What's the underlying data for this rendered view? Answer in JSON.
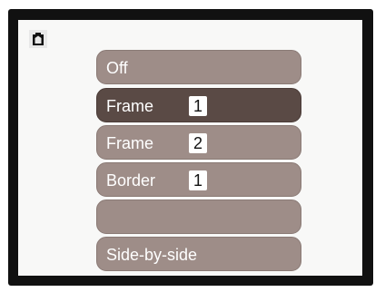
{
  "colors": {
    "frame": "#111111",
    "screen": "#f8f8f7",
    "item": "#9e8d88",
    "item_selected": "#5a4a45",
    "text": "#ffffff",
    "badge": "#ffffff"
  },
  "header": {
    "icon": "camera-mode-icon"
  },
  "menu": {
    "selected_index": 1,
    "items": [
      {
        "label": "Off",
        "badge": ""
      },
      {
        "label": "Frame",
        "badge": "1"
      },
      {
        "label": "Frame",
        "badge": "2"
      },
      {
        "label": "Border",
        "badge": "1"
      },
      {
        "label": "",
        "badge": ""
      },
      {
        "label": "Side-by-side",
        "badge": ""
      }
    ]
  }
}
